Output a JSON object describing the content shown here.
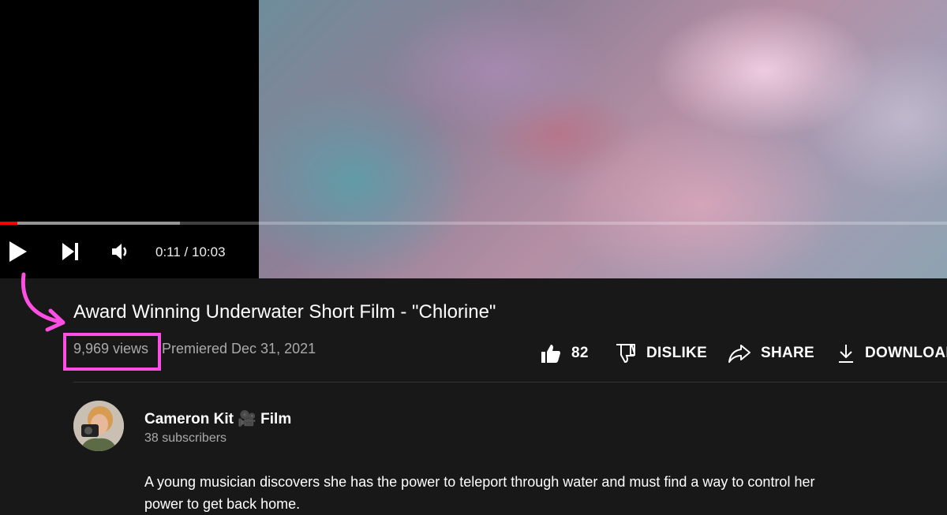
{
  "player": {
    "time_current": "0:11",
    "time_separator": " / ",
    "time_total": "10:03",
    "progress_played_fraction": 0.018,
    "progress_buffered_fraction": 0.19
  },
  "video": {
    "title": "Award Winning Underwater Short Film - \"Chlorine\"",
    "views": "9,969 views",
    "premiered": "Premiered Dec 31, 2021"
  },
  "actions": {
    "like_count": "82",
    "dislike_label": "DISLIKE",
    "share_label": "SHARE",
    "download_label": "DOWNLOAD"
  },
  "channel": {
    "name": "Cameron Kit 🎥 Film",
    "subscribers": "38 subscribers"
  },
  "description": "A young musician discovers she has the power to teleport through water and must find a way to control her power to get back home.",
  "annotation": {
    "color": "#ff4fe3"
  }
}
